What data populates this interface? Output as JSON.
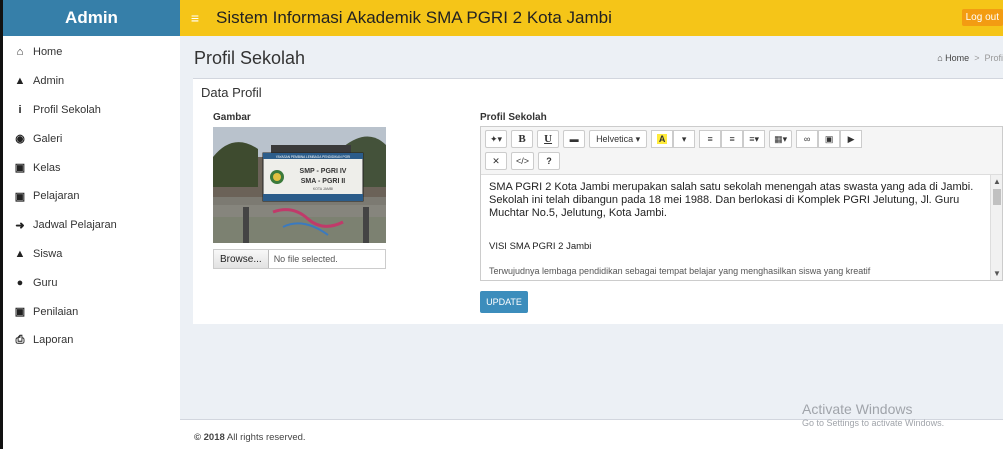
{
  "brand": "Admin",
  "header": {
    "menu_icon": "hamburger-icon",
    "title": "Sistem Informasi Akademik SMA PGRI 2 Kota Jambi",
    "logout_label": "Log out"
  },
  "sidebar": {
    "items": [
      {
        "label": "Home",
        "icon": "home-icon"
      },
      {
        "label": "Admin",
        "icon": "user-icon"
      },
      {
        "label": "Profil Sekolah",
        "icon": "info-icon"
      },
      {
        "label": "Galeri",
        "icon": "camera-icon"
      },
      {
        "label": "Kelas",
        "icon": "briefcase-icon"
      },
      {
        "label": "Pelajaran",
        "icon": "briefcase-icon"
      },
      {
        "label": "Jadwal Pelajaran",
        "icon": "arrow-right-icon"
      },
      {
        "label": "Siswa",
        "icon": "user-icon"
      },
      {
        "label": "Guru",
        "icon": "users-icon"
      },
      {
        "label": "Penilaian",
        "icon": "briefcase-icon"
      },
      {
        "label": "Laporan",
        "icon": "print-icon"
      }
    ]
  },
  "page": {
    "title": "Profil Sekolah",
    "breadcrumb_home": "Home",
    "breadcrumb_current": "Profi"
  },
  "form": {
    "box_title": "Data Profil",
    "image_label": "Gambar",
    "browse_label": "Browse...",
    "no_file": "No file selected.",
    "profile_label": "Profil Sekolah",
    "font_name": "Helvetica",
    "update_label": "UPDATE",
    "editor": {
      "paragraph1": "SMA PGRI 2 Kota Jambi merupakan salah satu sekolah menengah atas swasta yang ada di Jambi. Sekolah ini telah dibangun pada 18 mei 1988. Dan berlokasi di Komplek PGRI Jelutung, Jl. Guru Muchtar No.5, Jelutung, Kota Jambi.",
      "paragraph2": "VISI SMA PGRI 2 Jambi",
      "paragraph3": "Terwujudnya lembaga pendidikan sebagai tempat belajar yang menghasilkan siswa yang kreatif"
    },
    "photo": {
      "sign_line1": "YAYASAN PEMBINA LEMBAGA PENDIDIKAN PGRI",
      "sign_line2": "SMP - PGRI IV",
      "sign_line3": "SMA - PGRI II",
      "sign_line4": "KOTA JAMBI"
    }
  },
  "footer": {
    "year": "© 2018",
    "text": "All rights reserved."
  },
  "watermark": {
    "line1": "Activate Windows",
    "line2": "Go to Settings to activate Windows."
  }
}
